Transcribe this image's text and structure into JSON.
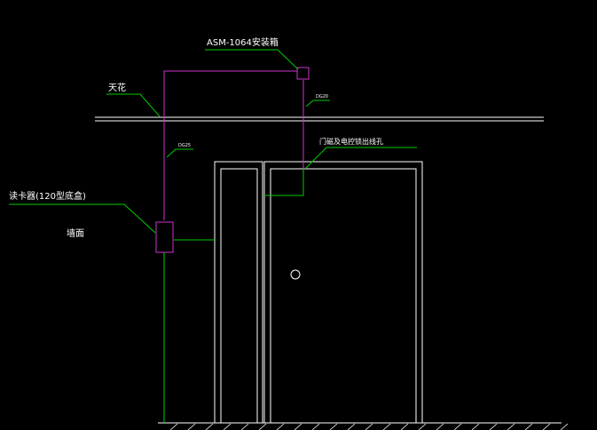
{
  "labels": {
    "device_box": "ASM-1064安装箱",
    "ceiling": "天花",
    "conduit_top": "DG20",
    "conduit_left": "DG25",
    "door_exit": "门磁及电控锁出线孔",
    "card_reader": "读卡器(120型底盒)",
    "wall": "墙面"
  },
  "colors": {
    "background": "#000000",
    "outline": "#ffffff",
    "conduit": "#cc33cc",
    "leader": "#00cc00",
    "text": "#ffffff"
  }
}
